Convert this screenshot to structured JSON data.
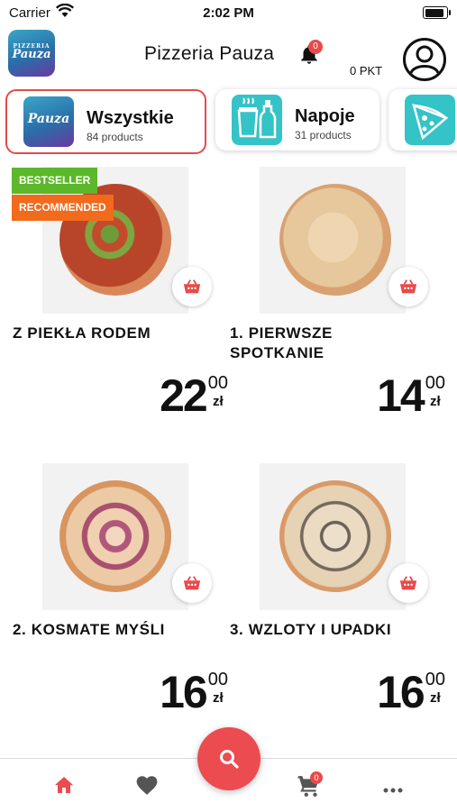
{
  "status_bar": {
    "carrier": "Carrier",
    "time": "2:02 PM"
  },
  "header": {
    "logo_text": "Pauza",
    "logo_small": "PIZZERIA",
    "title": "Pizzeria Pauza",
    "notification_count": "0",
    "points": "0 PKT"
  },
  "categories": [
    {
      "title": "Wszystkie",
      "subtitle": "84 products",
      "icon": "pauza-logo",
      "active": true
    },
    {
      "title": "Napoje",
      "subtitle": "31 products",
      "icon": "drinks-icon",
      "active": false
    },
    {
      "title": "",
      "subtitle": "",
      "icon": "pizza-slice-icon",
      "active": false
    }
  ],
  "products": [
    {
      "name_line1": "Z PIEKŁA RODEM",
      "name_line2": "",
      "price_main": "22",
      "price_cents": "00",
      "currency": "zł",
      "badges": [
        "BESTSELLER",
        "RECOMMENDED"
      ]
    },
    {
      "name_line1": "1. PIERWSZE",
      "name_line2": "SPOTKANIE",
      "price_main": "14",
      "price_cents": "00",
      "currency": "zł",
      "badges": []
    },
    {
      "name_line1": "2. KOSMATE MYŚLI",
      "name_line2": "",
      "price_main": "16",
      "price_cents": "00",
      "currency": "zł",
      "badges": []
    },
    {
      "name_line1": "3. WZLOTY I UPADKI",
      "name_line2": "",
      "price_main": "16",
      "price_cents": "00",
      "currency": "zł",
      "badges": []
    }
  ],
  "badge_colors": {
    "BESTSELLER": "#5cb82a",
    "RECOMMENDED": "#f26a1b"
  },
  "tab_bar": {
    "items": [
      "home-icon",
      "heart-icon",
      "search-icon",
      "cart-icon",
      "more-icon"
    ],
    "cart_count": "0",
    "accent": "#ec4b4f"
  }
}
